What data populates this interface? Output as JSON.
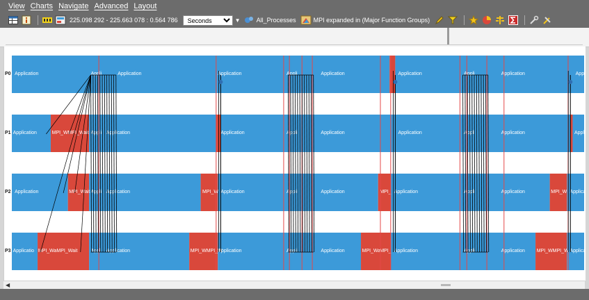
{
  "menu": [
    "View",
    "Charts",
    "Navigate",
    "Advanced",
    "Layout"
  ],
  "toolbar": {
    "time_range": "225.098 292 - 225.663 078 : 0.564 786",
    "units_value": "Seconds",
    "process_filter": "All_Processes",
    "function_grouping": "MPI expanded in (Major Function Groups)"
  },
  "icons": [
    "table-icon",
    "info-icon",
    "bar-chart-icon",
    "timeline-icon",
    "process-group-icon",
    "function-group-icon",
    "pencil-icon",
    "filter-icon",
    "star-icon",
    "pie-icon",
    "scale-icon",
    "sigma-icon",
    "settings-icon",
    "tools-icon"
  ],
  "colors": {
    "application": "#3c9ad9",
    "mpi": "#d9483b",
    "message_line": "#000000",
    "marker_line": "#e54848"
  },
  "timeline": {
    "processes": [
      {
        "label": "P0",
        "segments": [
          {
            "x0": 0.0,
            "x1": 0.66,
            "kind": "app",
            "text": "Application"
          },
          {
            "x0": 0.66,
            "x1": 0.67,
            "kind": "mpi",
            "text": ""
          },
          {
            "x0": 0.67,
            "x1": 1.0,
            "kind": "app",
            "text": "Application"
          }
        ],
        "labels": [
          {
            "x": 0.005,
            "text": "Application"
          },
          {
            "x": 0.138,
            "text": "Appli"
          },
          {
            "x": 0.185,
            "text": "Application"
          },
          {
            "x": 0.36,
            "text": "Application"
          },
          {
            "x": 0.48,
            "text": "Appli"
          },
          {
            "x": 0.54,
            "text": "Application"
          },
          {
            "x": 0.675,
            "text": "Application"
          },
          {
            "x": 0.79,
            "text": "Appli"
          },
          {
            "x": 0.855,
            "text": "Application"
          },
          {
            "x": 0.985,
            "text": "Application"
          }
        ]
      },
      {
        "label": "P1",
        "segments": [
          {
            "x0": 0.0,
            "x1": 0.068,
            "kind": "app",
            "text": "Application"
          },
          {
            "x0": 0.068,
            "x1": 0.135,
            "kind": "mpi",
            "text": "MPI_WMPI_Wait"
          },
          {
            "x0": 0.135,
            "x1": 0.357,
            "kind": "app",
            "text": ""
          },
          {
            "x0": 0.357,
            "x1": 0.365,
            "kind": "mpi",
            "text": ""
          },
          {
            "x0": 0.365,
            "x1": 0.976,
            "kind": "app",
            "text": ""
          },
          {
            "x0": 0.976,
            "x1": 0.98,
            "kind": "mpi",
            "text": ""
          },
          {
            "x0": 0.98,
            "x1": 1.0,
            "kind": "app",
            "text": ""
          }
        ],
        "labels": [
          {
            "x": 0.002,
            "text": "Application"
          },
          {
            "x": 0.07,
            "text": "MPI_WMPI_Wait"
          },
          {
            "x": 0.138,
            "text": "Appli"
          },
          {
            "x": 0.165,
            "text": "Application"
          },
          {
            "x": 0.365,
            "text": "Application"
          },
          {
            "x": 0.48,
            "text": "Appli"
          },
          {
            "x": 0.54,
            "text": "Application"
          },
          {
            "x": 0.675,
            "text": "Application"
          },
          {
            "x": 0.79,
            "text": "Appli"
          },
          {
            "x": 0.855,
            "text": "Application"
          },
          {
            "x": 0.983,
            "text": "Applicati"
          }
        ]
      },
      {
        "label": "P2",
        "segments": [
          {
            "x0": 0.0,
            "x1": 0.098,
            "kind": "app",
            "text": ""
          },
          {
            "x0": 0.098,
            "x1": 0.135,
            "kind": "mpi",
            "text": ""
          },
          {
            "x0": 0.135,
            "x1": 0.33,
            "kind": "app",
            "text": ""
          },
          {
            "x0": 0.33,
            "x1": 0.36,
            "kind": "mpi",
            "text": ""
          },
          {
            "x0": 0.36,
            "x1": 0.64,
            "kind": "app",
            "text": ""
          },
          {
            "x0": 0.64,
            "x1": 0.662,
            "kind": "mpi",
            "text": ""
          },
          {
            "x0": 0.662,
            "x1": 0.94,
            "kind": "app",
            "text": ""
          },
          {
            "x0": 0.94,
            "x1": 0.97,
            "kind": "mpi",
            "text": ""
          },
          {
            "x0": 0.97,
            "x1": 1.0,
            "kind": "app",
            "text": ""
          }
        ],
        "labels": [
          {
            "x": 0.005,
            "text": "Application"
          },
          {
            "x": 0.1,
            "text": "MPI_Wait"
          },
          {
            "x": 0.138,
            "text": "Appli"
          },
          {
            "x": 0.165,
            "text": "Application"
          },
          {
            "x": 0.333,
            "text": "MPI_W"
          },
          {
            "x": 0.365,
            "text": "Application"
          },
          {
            "x": 0.48,
            "text": "Appli"
          },
          {
            "x": 0.54,
            "text": "Application"
          },
          {
            "x": 0.643,
            "text": "MPI_"
          },
          {
            "x": 0.668,
            "text": "Application"
          },
          {
            "x": 0.79,
            "text": "Appli"
          },
          {
            "x": 0.855,
            "text": "Application"
          },
          {
            "x": 0.942,
            "text": "MPI_W"
          },
          {
            "x": 0.975,
            "text": "Applicati"
          }
        ]
      },
      {
        "label": "P3",
        "segments": [
          {
            "x0": 0.0,
            "x1": 0.045,
            "kind": "app",
            "text": ""
          },
          {
            "x0": 0.045,
            "x1": 0.135,
            "kind": "mpi",
            "text": ""
          },
          {
            "x0": 0.135,
            "x1": 0.31,
            "kind": "app",
            "text": ""
          },
          {
            "x0": 0.31,
            "x1": 0.36,
            "kind": "mpi",
            "text": ""
          },
          {
            "x0": 0.36,
            "x1": 0.61,
            "kind": "app",
            "text": ""
          },
          {
            "x0": 0.61,
            "x1": 0.662,
            "kind": "mpi",
            "text": ""
          },
          {
            "x0": 0.662,
            "x1": 0.915,
            "kind": "app",
            "text": ""
          },
          {
            "x0": 0.915,
            "x1": 0.97,
            "kind": "mpi",
            "text": ""
          },
          {
            "x0": 0.97,
            "x1": 1.0,
            "kind": "app",
            "text": ""
          }
        ],
        "labels": [
          {
            "x": 0.002,
            "text": "Applicatio"
          },
          {
            "x": 0.046,
            "text": "MPI_WaMPI_Wait"
          },
          {
            "x": 0.138,
            "text": "Appl"
          },
          {
            "x": 0.165,
            "text": "Application"
          },
          {
            "x": 0.312,
            "text": "MPI_WMPI_W"
          },
          {
            "x": 0.36,
            "text": "Application"
          },
          {
            "x": 0.48,
            "text": "Appli"
          },
          {
            "x": 0.54,
            "text": "Application"
          },
          {
            "x": 0.612,
            "text": "MPI_Wa"
          },
          {
            "x": 0.643,
            "text": "MPI_"
          },
          {
            "x": 0.668,
            "text": "Application"
          },
          {
            "x": 0.79,
            "text": "Appli"
          },
          {
            "x": 0.855,
            "text": "Application"
          },
          {
            "x": 0.917,
            "text": "MPI_WMPI_W"
          },
          {
            "x": 0.975,
            "text": "Applicati"
          }
        ]
      }
    ],
    "message_bursts": [
      0.16,
      0.505,
      0.81
    ],
    "single_messages": [
      0.365,
      0.67,
      0.976
    ],
    "marker_lines": [
      0.152,
      0.357,
      0.475,
      0.485,
      0.507,
      0.525,
      0.644,
      0.662,
      0.783,
      0.795,
      0.83,
      0.86,
      0.972
    ]
  }
}
